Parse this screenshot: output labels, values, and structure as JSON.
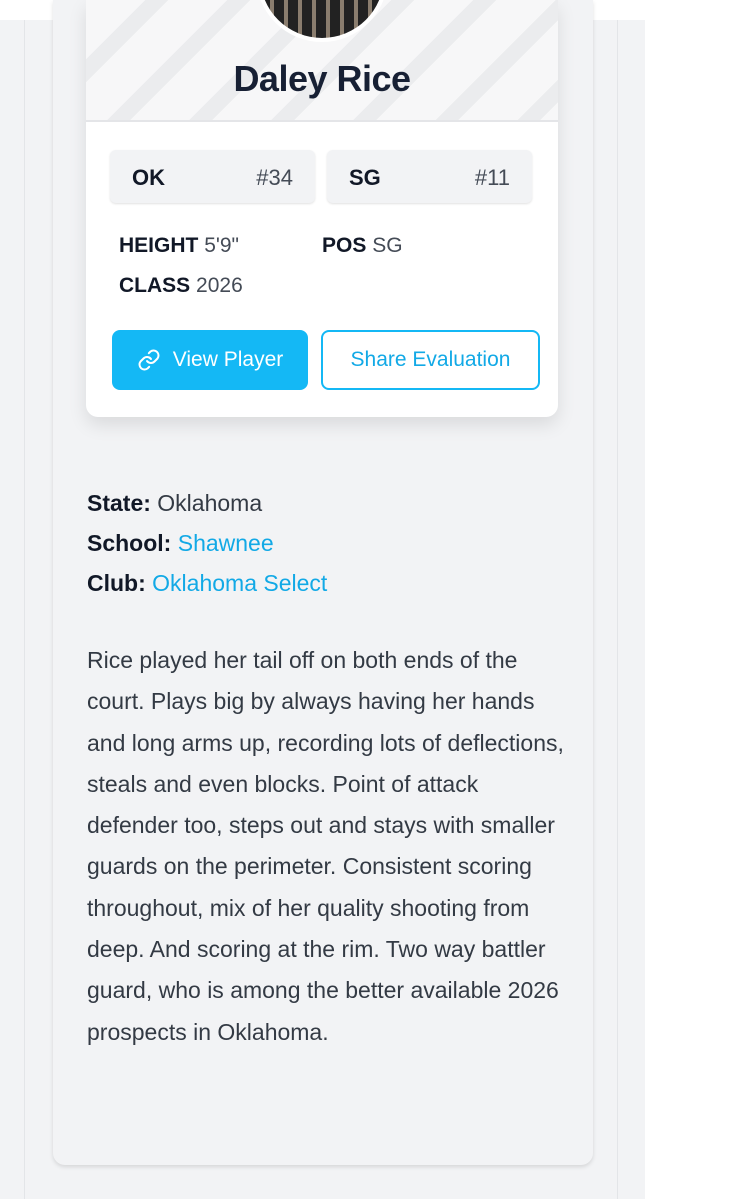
{
  "player": {
    "name": "Daley Rice",
    "state_abbr": "OK",
    "state_rank": "#34",
    "position_abbr": "SG",
    "position_rank": "#11",
    "height_label": "HEIGHT",
    "height_value": "5'9\"",
    "class_label": "CLASS",
    "class_value": "2026",
    "pos_label": "POS",
    "pos_value": "SG"
  },
  "actions": {
    "view_player": "View Player",
    "share_evaluation": "Share Evaluation"
  },
  "details": {
    "state_label": "State:",
    "state_value": "Oklahoma",
    "school_label": "School:",
    "school_value": "Shawnee",
    "club_label": "Club:",
    "club_value": "Oklahoma Select"
  },
  "evaluation": "Rice played her tail off on both ends of the court. Plays big by always having her hands and long arms up, recording lots of deflections, steals and even blocks. Point of attack defender too, steps out and stays with smaller guards on the perimeter. Consistent scoring throughout, mix of her quality shooting from deep. And scoring at the rim. Two way battler guard, who is among the better available 2026 prospects in Oklahoma.",
  "colors": {
    "accent": "#14b8f5",
    "link": "#12a9e6",
    "name": "#172034",
    "background": "#f2f3f5"
  },
  "icons": {
    "view_player": "link-icon"
  }
}
